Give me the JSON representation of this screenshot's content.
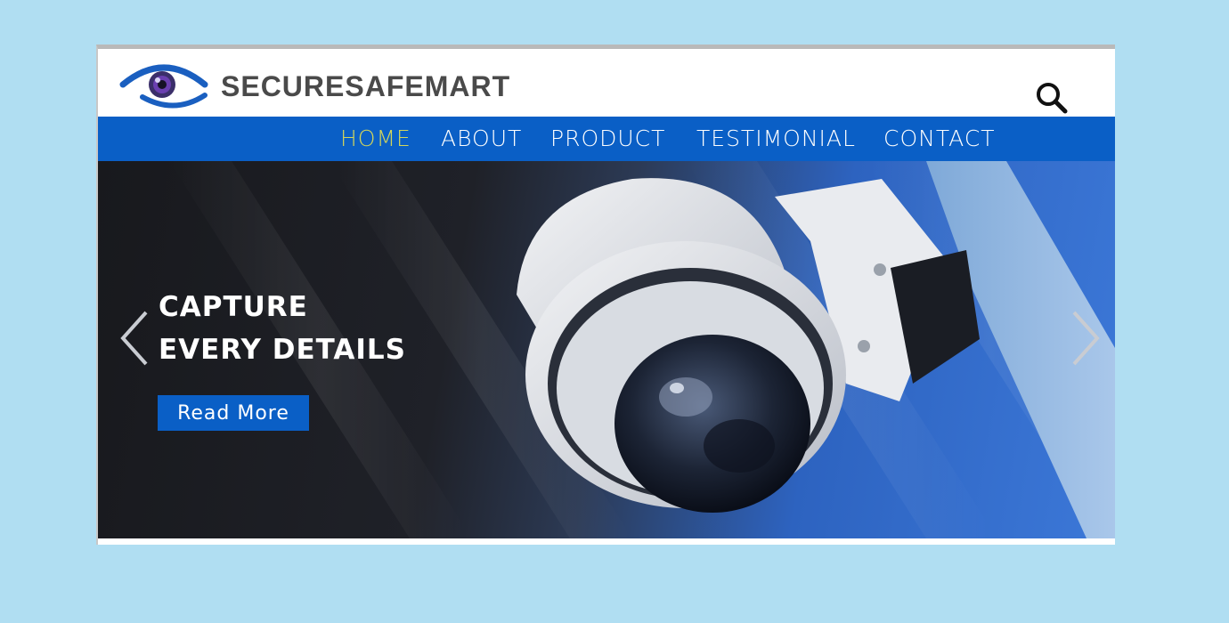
{
  "brand": {
    "name": "SECURESAFEMART",
    "logo_icon": "eye-logo-icon"
  },
  "header": {
    "search_icon": "search-icon"
  },
  "nav": {
    "items": [
      {
        "label": "HOME",
        "active": true
      },
      {
        "label": "ABOUT",
        "active": false
      },
      {
        "label": "PRODUCT",
        "active": false
      },
      {
        "label": "TESTIMONIAL",
        "active": false
      },
      {
        "label": "CONTACT",
        "active": false
      }
    ]
  },
  "hero": {
    "headline_line1": "CAPTURE",
    "headline_line2": "EVERY DETAILS",
    "cta_label": "Read More",
    "prev_icon": "chevron-left-icon",
    "next_icon": "chevron-right-icon"
  },
  "colors": {
    "background": "#b0def2",
    "nav_bar": "#0a5fc6",
    "nav_active": "#d4d65a",
    "cta": "#0a5fc6",
    "brand_text": "#4a4a4a"
  }
}
